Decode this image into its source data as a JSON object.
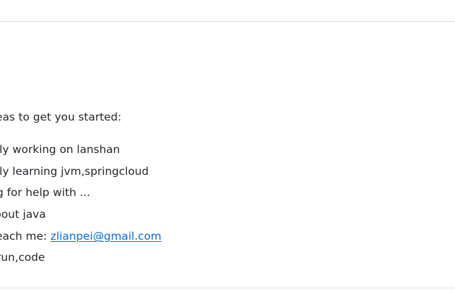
{
  "intro_text": "eas to get you started:",
  "items": [
    {
      "text": "tly working on lanshan"
    },
    {
      "text": "tly learning jvm,springcloud"
    },
    {
      "text": "g for help with ..."
    },
    {
      "text": "bout java"
    },
    {
      "prefix": "each me: ",
      "link_text": "zlianpei@gmail.com"
    },
    {
      "text": "run,code"
    }
  ],
  "colors": {
    "text": "#1f2328",
    "link": "#0969da",
    "divider": "#d8dee4"
  }
}
